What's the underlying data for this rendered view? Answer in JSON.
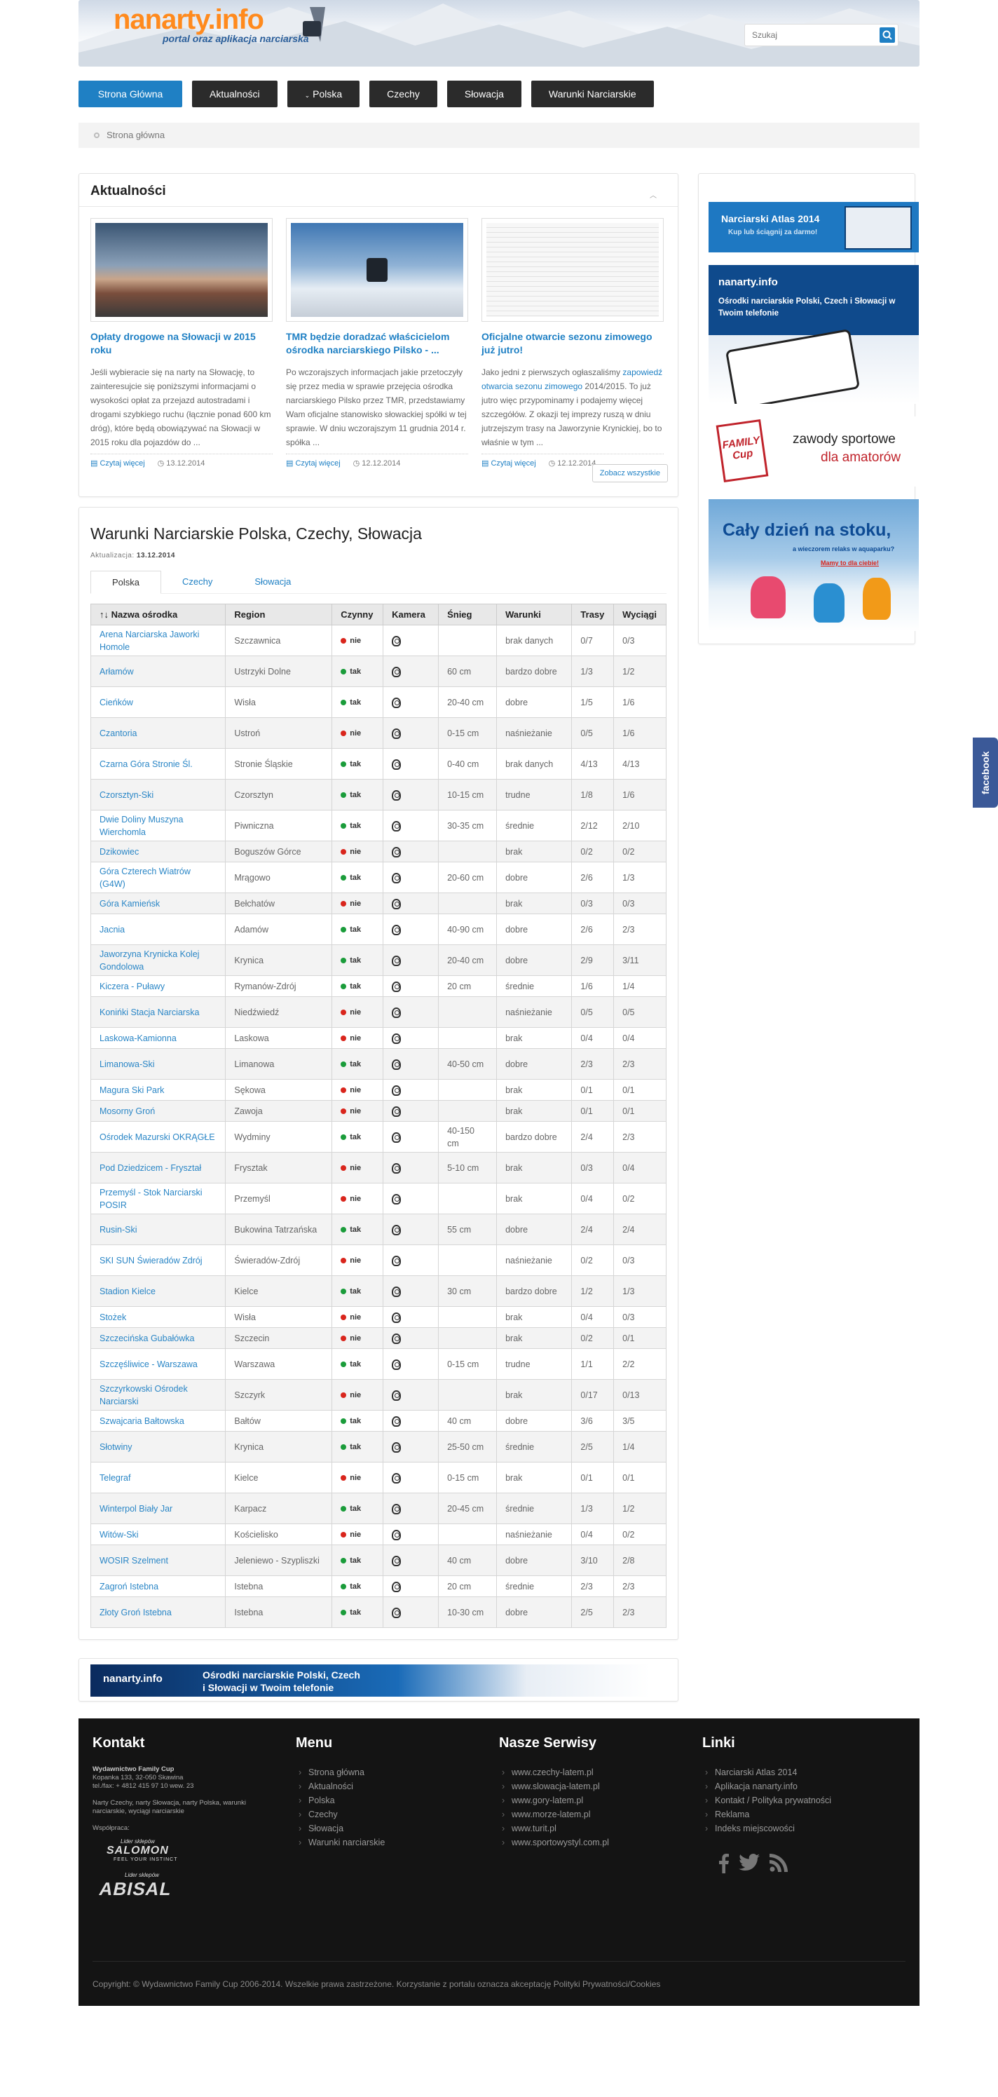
{
  "header": {
    "logo_text": "nanarty.info",
    "tagline": "portal oraz aplikacja narciarska",
    "search_placeholder": "Szukaj"
  },
  "nav": [
    {
      "label": "Strona Główna"
    },
    {
      "label": "Aktualności"
    },
    {
      "label": "Polska"
    },
    {
      "label": "Czechy"
    },
    {
      "label": "Słowacja"
    },
    {
      "label": "Warunki Narciarskie"
    }
  ],
  "breadcrumb": "Strona główna",
  "news": {
    "title": "Aktualności",
    "more_label": "Zobacz wszystkie",
    "read_more": "Czytaj więcej",
    "items": [
      {
        "title": "Opłaty drogowe na Słowacji w 2015 roku",
        "text": "Jeśli wybieracie się na narty na Słowację, to zainteresujcie się poniższymi informacjami o wysokości opłat za przejazd autostradami i drogami szybkiego ruchu (łącznie ponad 600 km dróg), które będą obowiązywać na Słowacji w 2015 roku dla pojazdów do ...",
        "date": "13.12.2014"
      },
      {
        "title": "TMR będzie doradzać właścicielom ośrodka narciarskiego Pilsko - ...",
        "text": "Po wczorajszych informacjach jakie przetoczyły się przez media w sprawie przejęcia ośrodka narciarskiego Pilsko przez TMR, przedstawiamy Wam oficjalne stanowisko słowackiej spółki w tej sprawie. W dniu wczorajszym 11 grudnia 2014 r. spółka ...",
        "date": "12.12.2014"
      },
      {
        "title": "Oficjalne otwarcie sezonu zimowego już jutro!",
        "text_pre": "Jako jedni z pierwszych ogłaszaliśmy ",
        "text_link": "zapowiedź otwarcia sezonu zimowego",
        "text_post": " 2014/2015. To już jutro więc przypominamy i podajemy więcej szczegółów. Z okazji tej imprezy ruszą w dniu jutrzejszym trasy na Jaworzynie Krynickiej, bo to właśnie w tym ...",
        "date": "12.12.2014"
      }
    ]
  },
  "ski": {
    "title": "Warunki Narciarskie Polska, Czechy, Słowacja",
    "updated_label": "Aktualizacja:",
    "updated_date": "13.12.2014",
    "tabs": [
      "Polska",
      "Czechy",
      "Słowacja"
    ],
    "columns": [
      "Nazwa ośrodka",
      "Region",
      "Czynny",
      "Kamera",
      "Śnieg",
      "Warunki",
      "Trasy",
      "Wyciągi"
    ],
    "rows": [
      [
        "Arena Narciarska Jaworki Homole",
        "Szczawnica",
        "nie",
        "",
        "brak danych",
        "0/7",
        "0/3"
      ],
      [
        "Arłamów",
        "Ustrzyki Dolne",
        "tak",
        "60 cm",
        "bardzo dobre",
        "1/3",
        "1/2"
      ],
      [
        "Cieńków",
        "Wisła",
        "tak",
        "20-40 cm",
        "dobre",
        "1/5",
        "1/6"
      ],
      [
        "Czantoria",
        "Ustroń",
        "nie",
        "0-15 cm",
        "naśnieżanie",
        "0/5",
        "1/6"
      ],
      [
        "Czarna Góra Stronie Śl.",
        "Stronie Śląskie",
        "tak",
        "0-40 cm",
        "brak danych",
        "4/13",
        "4/13"
      ],
      [
        "Czorsztyn-Ski",
        "Czorsztyn",
        "tak",
        "10-15 cm",
        "trudne",
        "1/8",
        "1/6"
      ],
      [
        "Dwie Doliny Muszyna Wierchomla",
        "Piwniczna",
        "tak",
        "30-35 cm",
        "średnie",
        "2/12",
        "2/10"
      ],
      [
        "Dzikowiec",
        "Boguszów Górce",
        "nie",
        "",
        "brak",
        "0/2",
        "0/2"
      ],
      [
        "Góra Czterech Wiatrów (G4W)",
        "Mrągowo",
        "tak",
        "20-60 cm",
        "dobre",
        "2/6",
        "1/3"
      ],
      [
        "Góra Kamieńsk",
        "Bełchatów",
        "nie",
        "",
        "brak",
        "0/3",
        "0/3"
      ],
      [
        "Jacnia",
        "Adamów",
        "tak",
        "40-90 cm",
        "dobre",
        "2/6",
        "2/3"
      ],
      [
        "Jaworzyna Krynicka Kolej Gondolowa",
        "Krynica",
        "tak",
        "20-40 cm",
        "dobre",
        "2/9",
        "3/11"
      ],
      [
        "Kiczera - Puławy",
        "Rymanów-Zdrój",
        "tak",
        "20 cm",
        "średnie",
        "1/6",
        "1/4"
      ],
      [
        "Konińki Stacja Narciarska",
        "Niedźwiedź",
        "nie",
        "",
        "naśnieżanie",
        "0/5",
        "0/5"
      ],
      [
        "Laskowa-Kamionna",
        "Laskowa",
        "nie",
        "",
        "brak",
        "0/4",
        "0/4"
      ],
      [
        "Limanowa-Ski",
        "Limanowa",
        "tak",
        "40-50 cm",
        "dobre",
        "2/3",
        "2/3"
      ],
      [
        "Magura Ski Park",
        "Sękowa",
        "nie",
        "",
        "brak",
        "0/1",
        "0/1"
      ],
      [
        "Mosorny Groń",
        "Zawoja",
        "nie",
        "",
        "brak",
        "0/1",
        "0/1"
      ],
      [
        "Ośrodek Mazurski OKRĄGŁE",
        "Wydminy",
        "tak",
        "40-150 cm",
        "bardzo dobre",
        "2/4",
        "2/3"
      ],
      [
        "Pod Dziedzicem - Fryształ",
        "Frysztak",
        "nie",
        "5-10 cm",
        "brak",
        "0/3",
        "0/4"
      ],
      [
        "Przemyśl - Stok Narciarski POSIR",
        "Przemyśl",
        "nie",
        "",
        "brak",
        "0/4",
        "0/2"
      ],
      [
        "Rusin-Ski",
        "Bukowina Tatrzańska",
        "tak",
        "55 cm",
        "dobre",
        "2/4",
        "2/4"
      ],
      [
        "SKI SUN Świeradów Zdrój",
        "Świeradów-Zdrój",
        "nie",
        "",
        "naśnieżanie",
        "0/2",
        "0/3"
      ],
      [
        "Stadion Kielce",
        "Kielce",
        "tak",
        "30 cm",
        "bardzo dobre",
        "1/2",
        "1/3"
      ],
      [
        "Stożek",
        "Wisła",
        "nie",
        "",
        "brak",
        "0/4",
        "0/3"
      ],
      [
        "Szczecińska Gubałówka",
        "Szczecin",
        "nie",
        "",
        "brak",
        "0/2",
        "0/1"
      ],
      [
        "Szczęśliwice - Warszawa",
        "Warszawa",
        "tak",
        "0-15 cm",
        "trudne",
        "1/1",
        "2/2"
      ],
      [
        "Szczyrkowski Ośrodek Narciarski",
        "Szczyrk",
        "nie",
        "",
        "brak",
        "0/17",
        "0/13"
      ],
      [
        "Szwajcaria Bałtowska",
        "Bałtów",
        "tak",
        "40 cm",
        "dobre",
        "3/6",
        "3/5"
      ],
      [
        "Słotwiny",
        "Krynica",
        "tak",
        "25-50 cm",
        "średnie",
        "2/5",
        "1/4"
      ],
      [
        "Telegraf",
        "Kielce",
        "nie",
        "0-15 cm",
        "brak",
        "0/1",
        "0/1"
      ],
      [
        "Winterpol Biały Jar",
        "Karpacz",
        "tak",
        "20-45 cm",
        "średnie",
        "1/3",
        "1/2"
      ],
      [
        "Witów-Ski",
        "Kościelisko",
        "nie",
        "",
        "naśnieżanie",
        "0/4",
        "0/2"
      ],
      [
        "WOSIR Szelment",
        "Jeleniewo - Szypliszki",
        "tak",
        "40 cm",
        "dobre",
        "3/10",
        "2/8"
      ],
      [
        "Zagroń Istebna",
        "Istebna",
        "tak",
        "20 cm",
        "średnie",
        "2/3",
        "2/3"
      ],
      [
        "Złoty Groń Istebna",
        "Istebna",
        "tak",
        "10-30 cm",
        "dobre",
        "2/5",
        "2/3"
      ]
    ]
  },
  "banner": {
    "logo": "nanarty.info",
    "text_line1": "Ośrodki narciarskie Polski, Czech",
    "text_line2": "i Słowacji w Twoim telefonie"
  },
  "sidebar": {
    "ad1_title": "Narciarski Atlas 2014",
    "ad1_sub": "Kup lub ściągnij za darmo!",
    "ad2_logo": "nanarty.info",
    "ad2_text": "Ośrodki narciarskie Polski, Czech i Słowacji w Twoim telefonie",
    "ad3_brand": "FAMILY Cup",
    "ad3_line1": "zawody sportowe",
    "ad3_line2": "dla amatorów",
    "ad4_title": "Cały dzień na stoku,",
    "ad4_sub": "a wieczorem relaks w aquaparku?",
    "ad4_link": "Mamy to dla ciebie!"
  },
  "footer": {
    "kontakt": {
      "title": "Kontakt",
      "company": "Wydawnictwo Family Cup",
      "address": "Kopanka 133, 32-050 Skawina",
      "phone": "tel./fax: + 4812 415 97 10 wew. 23",
      "desc": "Narty Czechy, narty Słowacja, narty Polska, warunki narciarskie, wyciągi narciarskie",
      "partners_label": "Współpraca:",
      "partner1_label": "Lider sklepów",
      "partner1": "SALOMON",
      "partner1_tag": "FEEL YOUR INSTINCT",
      "partner2_label": "Lider sklepów",
      "partner2": "ABISAL"
    },
    "menu": {
      "title": "Menu",
      "items": [
        "Strona główna",
        "Aktualności",
        "Polska",
        "Czechy",
        "Słowacja",
        "Warunki narciarskie"
      ]
    },
    "serwisy": {
      "title": "Nasze Serwisy",
      "items": [
        "www.czechy-latem.pl",
        "www.slowacja-latem.pl",
        "www.gory-latem.pl",
        "www.morze-latem.pl",
        "www.turit.pl",
        "www.sportowystyl.com.pl"
      ]
    },
    "linki": {
      "title": "Linki",
      "items": [
        "Narciarski Atlas 2014",
        "Aplikacja nanarty.info",
        "Kontakt / Polityka prywatności",
        "Reklama",
        "Indeks miejscowości"
      ]
    },
    "copyright": "Copyright: © Wydawnictwo Family Cup 2006-2014. Wszelkie prawa zastrzeżone. Korzystanie z portalu oznacza akceptację Polityki Prywatności/Cookies"
  },
  "facebook_tab": "facebook",
  "colors": {
    "accent": "#1f80c4",
    "nav_dark": "#2b2b2b",
    "open_green": "#1a9c3a",
    "closed_red": "#d9251c"
  }
}
